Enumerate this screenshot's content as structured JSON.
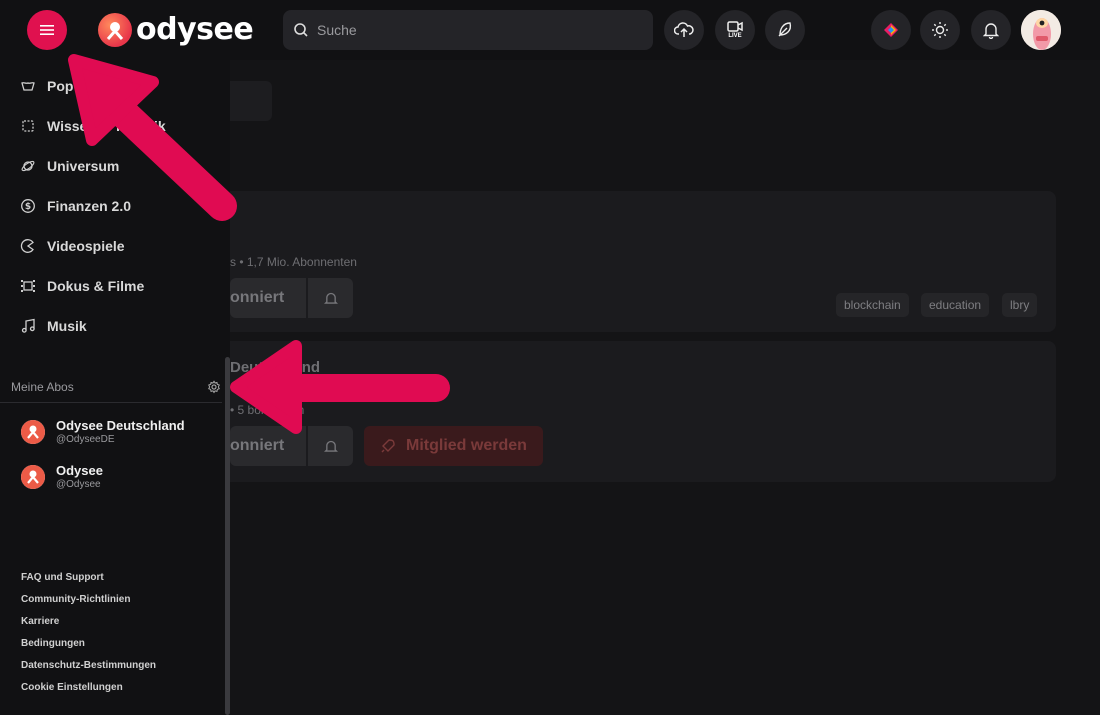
{
  "header": {
    "logo_text": "odysee",
    "search_placeholder": "Suche",
    "live_label": "LIVE"
  },
  "sidebar": {
    "items": [
      {
        "label": "Pop",
        "icon": "flame-icon"
      },
      {
        "label": "Wissen & Technik",
        "icon": "chip-icon"
      },
      {
        "label": "Universum",
        "icon": "planet-icon"
      },
      {
        "label": "Finanzen 2.0",
        "icon": "coin-icon"
      },
      {
        "label": "Videospiele",
        "icon": "gamepad-icon"
      },
      {
        "label": "Dokus & Filme",
        "icon": "film-icon"
      },
      {
        "label": "Musik",
        "icon": "music-icon"
      }
    ],
    "subs_heading": "Meine Abos",
    "subscriptions": [
      {
        "name": "Odysee Deutschland",
        "handle": "@OdyseeDE"
      },
      {
        "name": "Odysee",
        "handle": "@Odysee"
      }
    ],
    "footer_links": [
      "FAQ und Support",
      "Community-Richtlinien",
      "Karriere",
      "Bedingungen",
      "Datenschutz-Bestimmungen",
      "Cookie Einstellungen"
    ]
  },
  "main": {
    "cards": [
      {
        "meta": "s • 1,7 Mio. Abonnenten",
        "subscribe_label": "onniert",
        "tags": [
          "blockchain",
          "education",
          "lbry"
        ]
      },
      {
        "title": "Deutschland",
        "meta": "• 5 bonnenten",
        "subscribe_label": "onniert",
        "member_label": "Mitglied werden"
      }
    ]
  },
  "colors": {
    "accent": "#e0114f",
    "arrow": "#e00b52"
  }
}
